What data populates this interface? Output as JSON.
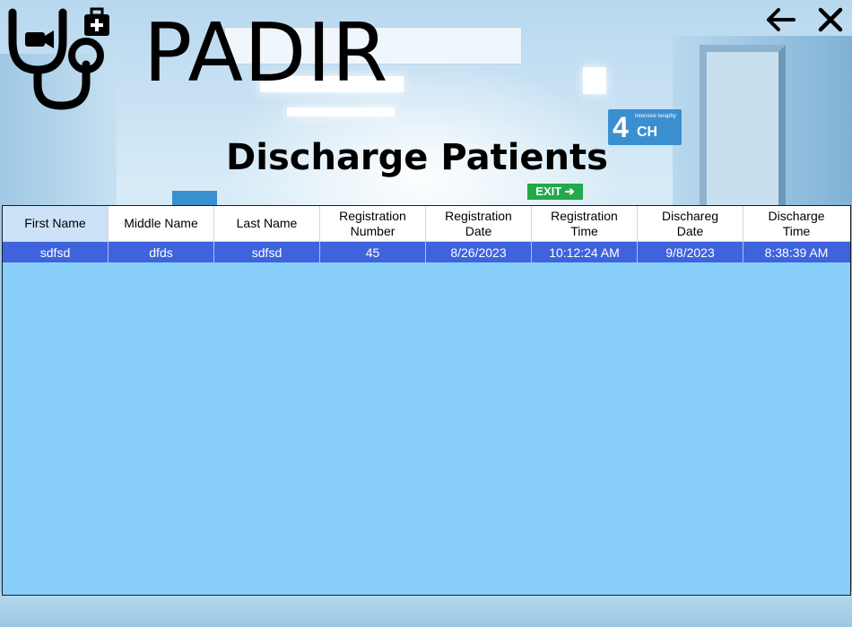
{
  "app": {
    "title": "PADIR",
    "page_title": "Discharge Patients"
  },
  "background": {
    "sign_room": "4",
    "sign_room_sub": "Intensive teraphy",
    "sign_room_code": "CH",
    "exit_sign": "EXIT"
  },
  "toolbar": {
    "back_icon": "arrow-left-icon",
    "close_icon": "close-icon"
  },
  "grid": {
    "columns": [
      "First Name",
      "Middle Name",
      "Last Name",
      "Registration\nNumber",
      "Registration\nDate",
      "Registration\nTime",
      "Dischareg\nDate",
      "Discharge\nTime"
    ],
    "rows": [
      [
        "sdfsd",
        "dfds",
        "sdfsd",
        "45",
        "8/26/2023",
        "10:12:24 AM",
        "9/8/2023",
        "8:38:39 AM"
      ]
    ]
  },
  "colors": {
    "grid_background": "#87cefa",
    "selected_row": "#3f63dd",
    "selected_header": "#cce3f7"
  }
}
